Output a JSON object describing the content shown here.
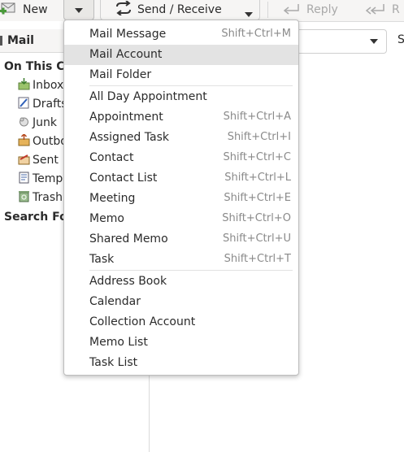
{
  "toolbar": {
    "new_label": "New",
    "send_receive_label": "Send / Receive",
    "reply_label": "Reply",
    "reply_all_label": "R"
  },
  "sidebar": {
    "header_label": "Mail",
    "account_label": "On This Co",
    "folders": [
      {
        "label": "Inbox",
        "icon": "inbox-icon"
      },
      {
        "label": "Drafts",
        "icon": "drafts-icon"
      },
      {
        "label": "Junk",
        "icon": "junk-icon"
      },
      {
        "label": "Outbo",
        "icon": "outbox-icon"
      },
      {
        "label": "Sent",
        "icon": "sent-icon"
      },
      {
        "label": "Templ",
        "icon": "templates-icon"
      },
      {
        "label": "Trash",
        "icon": "trash-icon"
      }
    ],
    "search_folders_label": "Search Fol"
  },
  "top_right_s": "S",
  "menu": {
    "groups": [
      [
        {
          "label": "Mail Message",
          "shortcut": "Shift+Ctrl+M"
        },
        {
          "label": "Mail Account",
          "shortcut": "",
          "active": true
        },
        {
          "label": "Mail Folder",
          "shortcut": ""
        }
      ],
      [
        {
          "label": "All Day Appointment",
          "shortcut": ""
        },
        {
          "label": "Appointment",
          "shortcut": "Shift+Ctrl+A"
        },
        {
          "label": "Assigned Task",
          "shortcut": "Shift+Ctrl+I"
        },
        {
          "label": "Contact",
          "shortcut": "Shift+Ctrl+C"
        },
        {
          "label": "Contact List",
          "shortcut": "Shift+Ctrl+L"
        },
        {
          "label": "Meeting",
          "shortcut": "Shift+Ctrl+E"
        },
        {
          "label": "Memo",
          "shortcut": "Shift+Ctrl+O"
        },
        {
          "label": "Shared Memo",
          "shortcut": "Shift+Ctrl+U"
        },
        {
          "label": "Task",
          "shortcut": "Shift+Ctrl+T"
        }
      ],
      [
        {
          "label": "Address Book",
          "shortcut": ""
        },
        {
          "label": "Calendar",
          "shortcut": ""
        },
        {
          "label": "Collection Account",
          "shortcut": ""
        },
        {
          "label": "Memo List",
          "shortcut": ""
        },
        {
          "label": "Task List",
          "shortcut": ""
        }
      ]
    ]
  }
}
